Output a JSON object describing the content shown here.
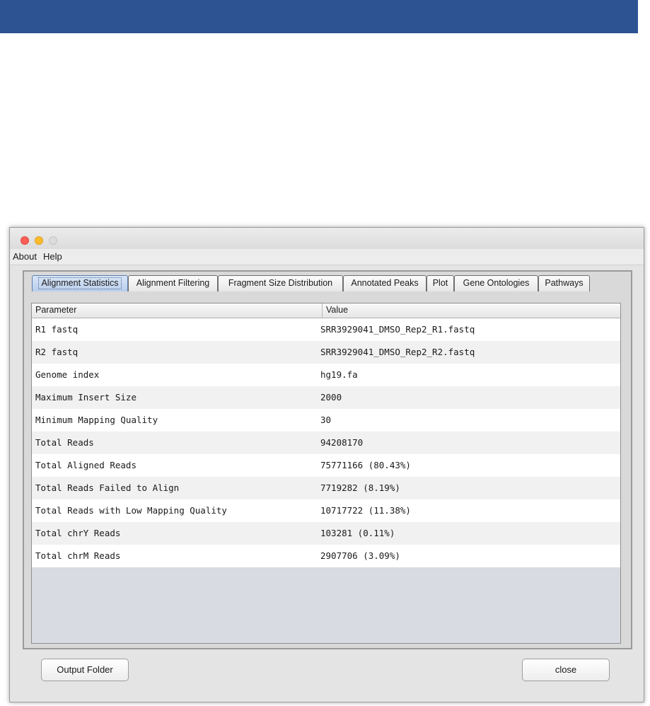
{
  "menu": {
    "items": [
      "About",
      "Help"
    ]
  },
  "tabs": [
    {
      "label": "Alignment Statistics",
      "active": true
    },
    {
      "label": "Alignment Filtering",
      "active": false
    },
    {
      "label": "Fragment Size Distribution",
      "active": false
    },
    {
      "label": "Annotated Peaks",
      "active": false
    },
    {
      "label": "Plot",
      "active": false
    },
    {
      "label": "Gene Ontologies",
      "active": false
    },
    {
      "label": "Pathways",
      "active": false
    }
  ],
  "table": {
    "columns": [
      "Parameter",
      "Value"
    ],
    "rows": [
      [
        "R1 fastq",
        "SRR3929041_DMSO_Rep2_R1.fastq"
      ],
      [
        "R2 fastq",
        "SRR3929041_DMSO_Rep2_R2.fastq"
      ],
      [
        "Genome index",
        "hg19.fa"
      ],
      [
        "Maximum Insert Size",
        "2000"
      ],
      [
        "Minimum Mapping Quality",
        "30"
      ],
      [
        "Total Reads",
        "94208170"
      ],
      [
        "Total Aligned Reads",
        "75771166 (80.43%)"
      ],
      [
        "Total Reads Failed to Align",
        "7719282 (8.19%)"
      ],
      [
        "Total Reads with Low Mapping Quality",
        "10717722 (11.38%)"
      ],
      [
        "Total chrY Reads",
        "103281 (0.11%)"
      ],
      [
        "Total chrM Reads",
        "2907706 (3.09%)"
      ]
    ]
  },
  "buttons": {
    "output_folder": "Output Folder",
    "close": "close"
  },
  "colors": {
    "header_bar": "#2d5393",
    "active_tab": "#b9cdeb"
  }
}
